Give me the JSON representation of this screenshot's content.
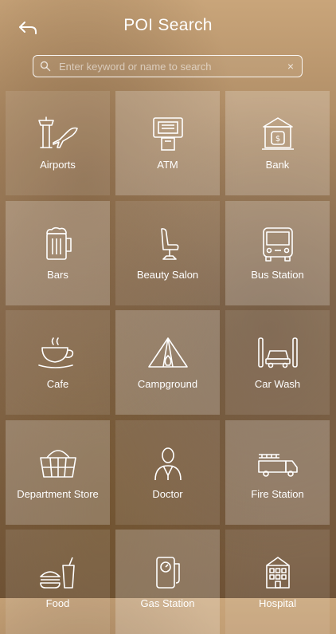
{
  "header": {
    "title": "POI Search",
    "back_icon": "back-arrow-icon"
  },
  "search": {
    "placeholder": "Enter keyword or name to search",
    "value": "",
    "clear_label": "×"
  },
  "categories": [
    {
      "label": "Airports",
      "icon": "airport-icon"
    },
    {
      "label": "ATM",
      "icon": "atm-icon"
    },
    {
      "label": "Bank",
      "icon": "bank-icon"
    },
    {
      "label": "Bars",
      "icon": "beer-mug-icon"
    },
    {
      "label": "Beauty Salon",
      "icon": "salon-chair-icon"
    },
    {
      "label": "Bus Station",
      "icon": "bus-icon"
    },
    {
      "label": "Cafe",
      "icon": "coffee-cup-icon"
    },
    {
      "label": "Campground",
      "icon": "tent-icon"
    },
    {
      "label": "Car Wash",
      "icon": "car-wash-icon"
    },
    {
      "label": "Department Store",
      "icon": "shopping-basket-icon"
    },
    {
      "label": "Doctor",
      "icon": "doctor-icon"
    },
    {
      "label": "Fire Station",
      "icon": "fire-truck-icon"
    },
    {
      "label": "Food",
      "icon": "burger-drink-icon"
    },
    {
      "label": "Gas Station",
      "icon": "gas-pump-icon"
    },
    {
      "label": "Hospital",
      "icon": "hospital-icon"
    }
  ]
}
